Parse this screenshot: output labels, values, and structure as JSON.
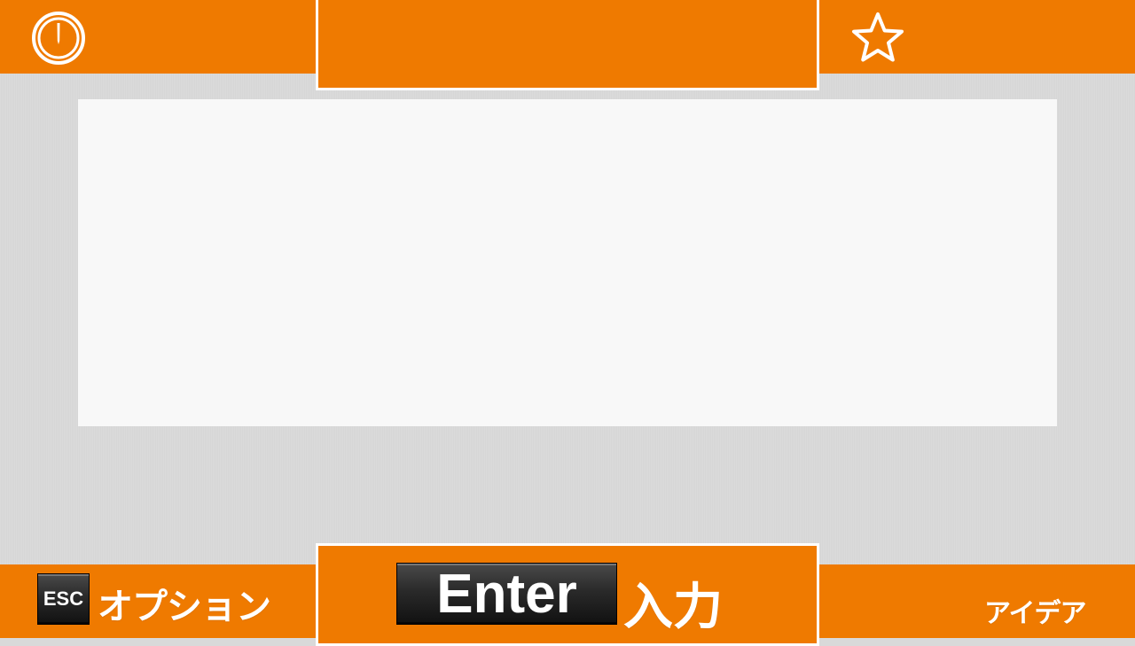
{
  "top_bar": {
    "left_icon": "clock-icon",
    "right_icon": "star-icon",
    "center_title": ""
  },
  "bottom_bar": {
    "esc_key": "ESC",
    "options_label": "オプション",
    "enter_key": "Enter",
    "input_label": "入力",
    "idea_label": "アイデア"
  },
  "colors": {
    "accent": "#ef7a00",
    "background": "#d9d9d9",
    "panel": "#f8f8f8",
    "key": "#1a1a1a"
  }
}
